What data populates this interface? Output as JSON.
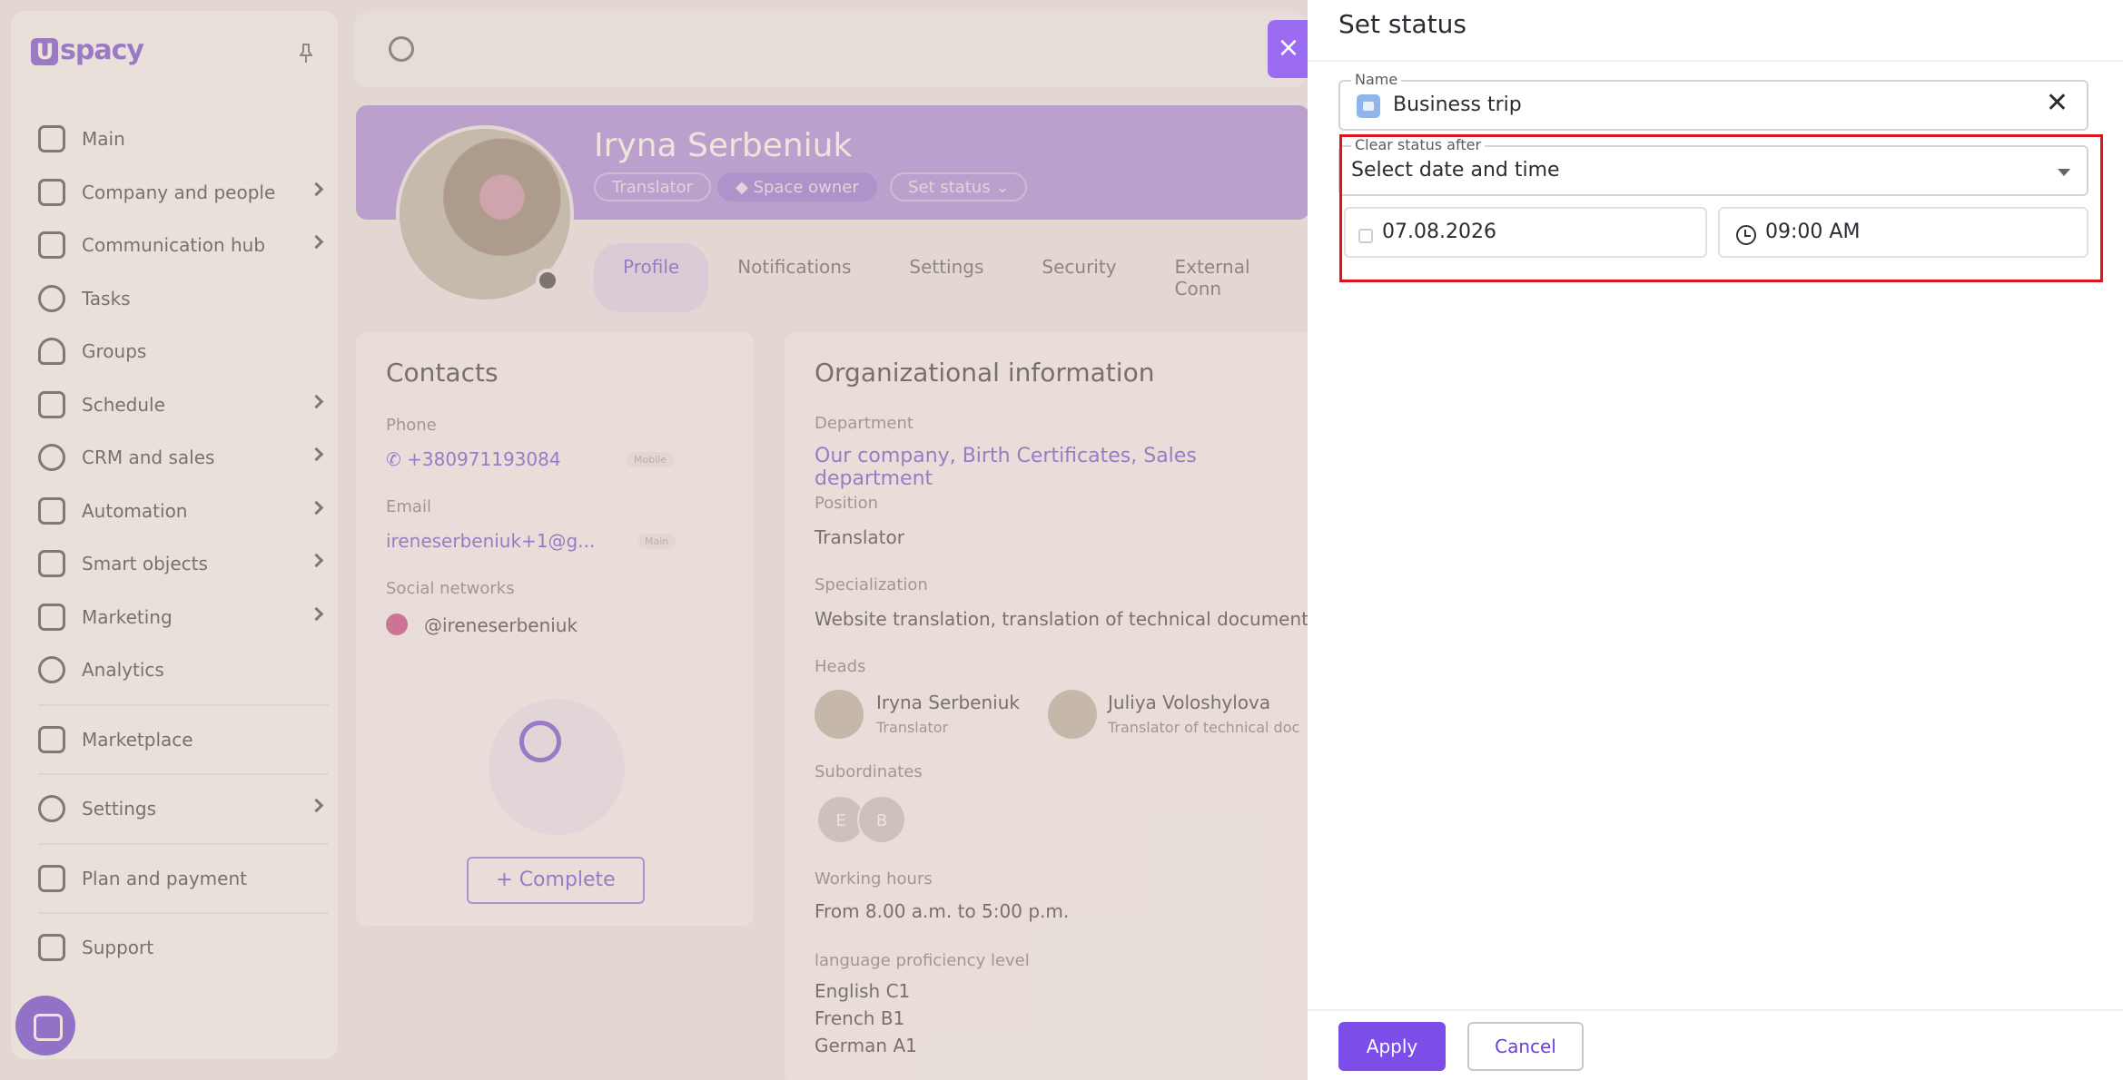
{
  "brand": {
    "logo_text": "spacy",
    "logo_letter": "U"
  },
  "sidebar": {
    "items": [
      {
        "label": "Main",
        "icon": "home-icon",
        "chevron": false
      },
      {
        "label": "Company and people",
        "icon": "company-icon",
        "chevron": true
      },
      {
        "label": "Communication hub",
        "icon": "chat-icon",
        "chevron": true
      },
      {
        "label": "Tasks",
        "icon": "check-circle-icon",
        "chevron": false
      },
      {
        "label": "Groups",
        "icon": "groups-icon",
        "chevron": false
      },
      {
        "label": "Schedule",
        "icon": "calendar-icon",
        "chevron": true
      },
      {
        "label": "CRM and sales",
        "icon": "crm-icon",
        "chevron": true
      },
      {
        "label": "Automation",
        "icon": "lightning-icon",
        "chevron": true
      },
      {
        "label": "Smart objects",
        "icon": "smart-objects-icon",
        "chevron": true
      },
      {
        "label": "Marketing",
        "icon": "marketing-icon",
        "chevron": true
      },
      {
        "label": "Analytics",
        "icon": "analytics-icon",
        "chevron": false
      }
    ],
    "marketplace": "Marketplace",
    "settings": "Settings",
    "plan": "Plan and payment",
    "support": "Support"
  },
  "profile": {
    "name": "Iryna Serbeniuk",
    "chips": {
      "role": "Translator",
      "owner": "Space owner",
      "set_status": "Set status"
    },
    "tabs": [
      "Profile",
      "Notifications",
      "Settings",
      "Security",
      "External Conn"
    ]
  },
  "contacts": {
    "title": "Contacts",
    "phone_label": "Phone",
    "phone": "+380971193084",
    "phone_tag": "Mobile",
    "email_label": "Email",
    "email": "ireneserbeniuk+1@g...",
    "email_tag": "Main",
    "social_label": "Social networks",
    "social": "@ireneserbeniuk",
    "complete": "+   Complete"
  },
  "org": {
    "title": "Organizational information",
    "department_label": "Department",
    "departments": [
      "Our company,",
      "Birth Certificates,",
      "Sales department"
    ],
    "position_label": "Position",
    "position": "Translator",
    "specialization_label": "Specialization",
    "specialization": "Website translation, translation of technical documentatio",
    "heads_label": "Heads",
    "head1_name": "Iryna Serbeniuk",
    "head1_role": "Translator",
    "head2_name": "Juliya Voloshylova",
    "head2_role": "Translator of technical doc",
    "subordinates_label": "Subordinates",
    "sub1": "E",
    "sub2": "B",
    "hours_label": "Working hours",
    "hours": "From 8.00 a.m. to 5:00 p.m.",
    "lang_label": "language proficiency level",
    "langs": [
      "English C1",
      "French B1",
      "German A1"
    ]
  },
  "drawer": {
    "close": "×",
    "title": "Set status",
    "name_label": "Name",
    "name_value": "Business trip",
    "clear_label": "Clear status after",
    "clear_value": "Select date and time",
    "date_value": "07.08.2026",
    "time_value": "09:00 AM",
    "apply": "Apply",
    "cancel": "Cancel"
  },
  "colors": {
    "accent": "#7c4de8",
    "highlight": "#e0141c",
    "status_icon": "#8fb5ea"
  }
}
